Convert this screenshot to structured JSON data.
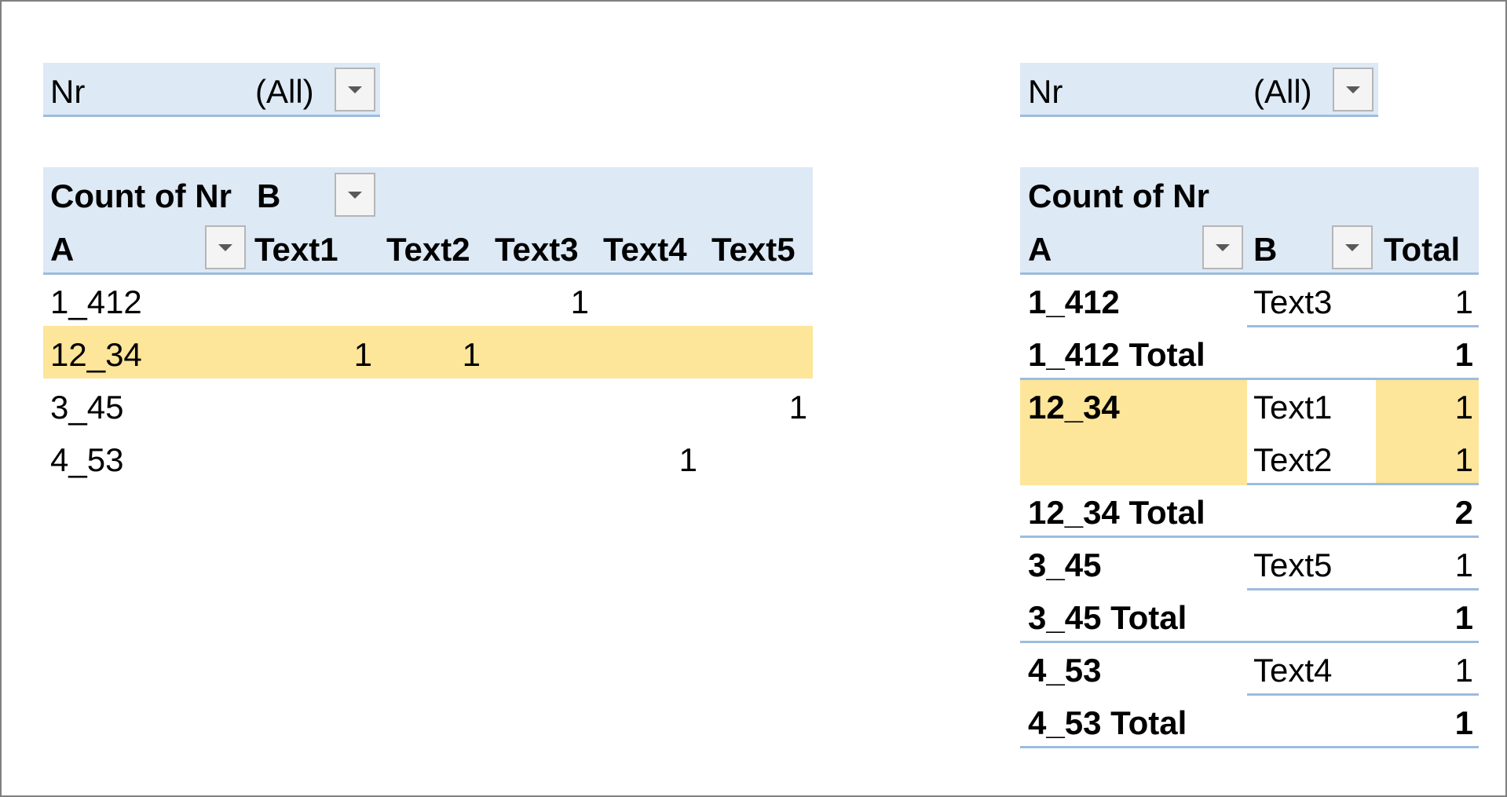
{
  "left": {
    "filter": {
      "field": "Nr",
      "value": "(All)"
    },
    "header": {
      "count_label": "Count of Nr",
      "col_field": "B",
      "row_field": "A",
      "columns": [
        "Text1",
        "Text2",
        "Text3",
        "Text4",
        "Text5"
      ]
    },
    "rows": [
      {
        "label": "1_412",
        "values": [
          "",
          "",
          "1",
          "",
          ""
        ]
      },
      {
        "label": "12_34",
        "values": [
          "1",
          "1",
          "",
          "",
          ""
        ]
      },
      {
        "label": "3_45",
        "values": [
          "",
          "",
          "",
          "",
          "1"
        ]
      },
      {
        "label": "4_53",
        "values": [
          "",
          "",
          "",
          "1",
          ""
        ]
      }
    ],
    "highlight_color": "#fde59a"
  },
  "right": {
    "filter": {
      "field": "Nr",
      "value": "(All)"
    },
    "header": {
      "count_label": "Count of Nr",
      "field_a": "A",
      "field_b": "B",
      "total_label": "Total"
    },
    "rows": [
      {
        "a": "1_412",
        "b": "Text3",
        "v": "1"
      },
      {
        "a": "1_412 Total",
        "b": "",
        "v": "1"
      },
      {
        "a": "12_34",
        "b": "Text1",
        "v": "1"
      },
      {
        "a": "",
        "b": "Text2",
        "v": "1"
      },
      {
        "a": "12_34 Total",
        "b": "",
        "v": "2"
      },
      {
        "a": "3_45",
        "b": "Text5",
        "v": "1"
      },
      {
        "a": "3_45 Total",
        "b": "",
        "v": "1"
      },
      {
        "a": "4_53",
        "b": "Text4",
        "v": "1"
      },
      {
        "a": "4_53 Total",
        "b": "",
        "v": "1"
      }
    ],
    "header_band_color": "#dde9f5",
    "border_color": "#9dbcdf"
  }
}
